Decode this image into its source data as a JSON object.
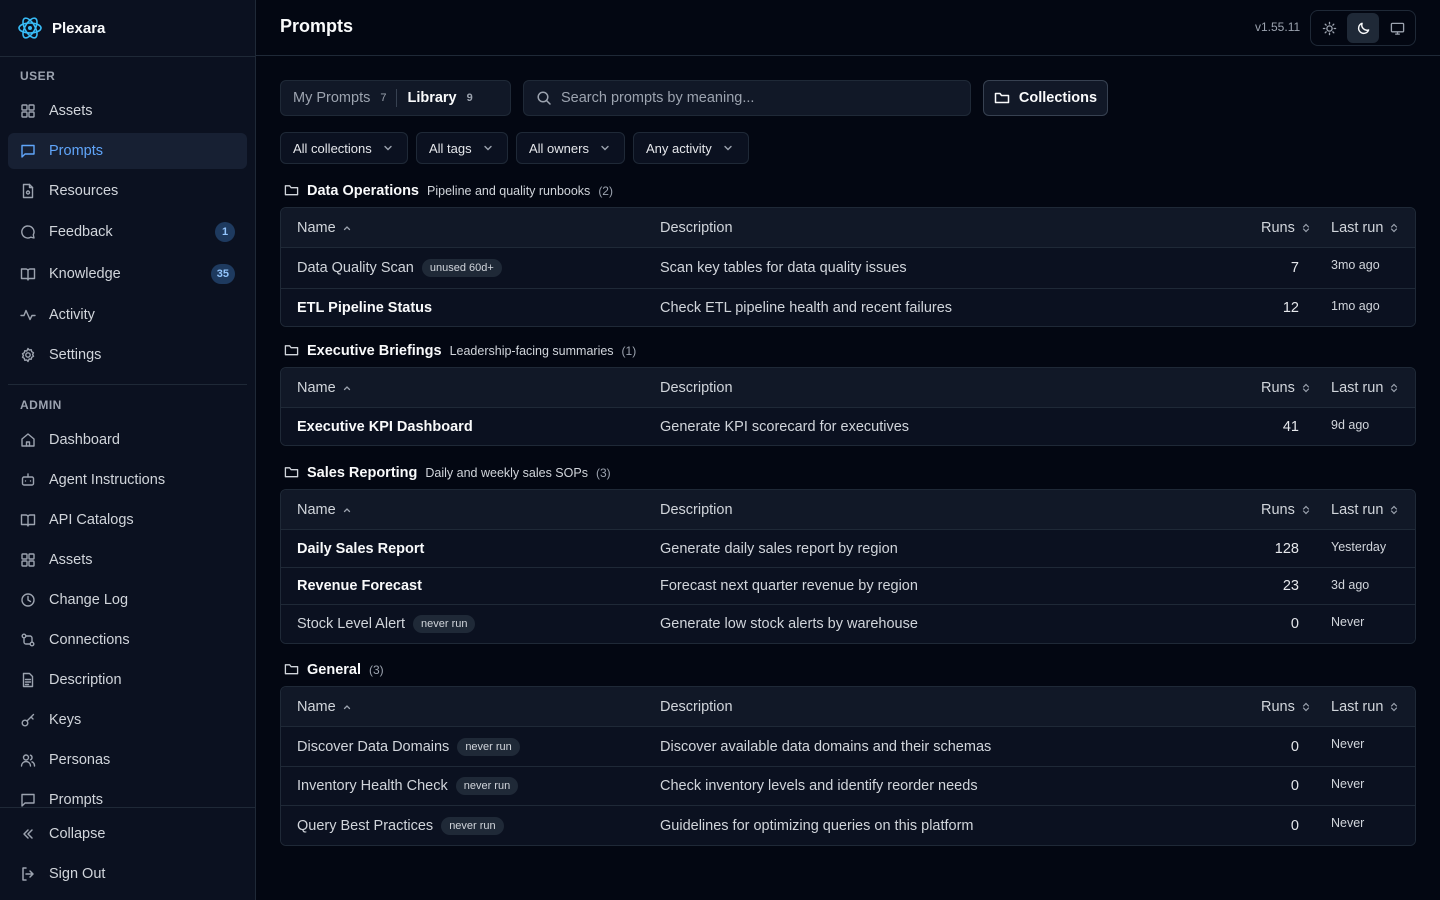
{
  "brand": {
    "name": "Plexara"
  },
  "sidebar": {
    "user_label": "USER",
    "admin_label": "ADMIN",
    "user_items": [
      {
        "label": "Assets",
        "icon": "grid-icon"
      },
      {
        "label": "Prompts",
        "icon": "message-square-icon",
        "active": true
      },
      {
        "label": "Resources",
        "icon": "file-icon"
      },
      {
        "label": "Feedback",
        "icon": "message-circle-icon",
        "badge": "1"
      },
      {
        "label": "Knowledge",
        "icon": "book-open-icon",
        "badge": "35"
      },
      {
        "label": "Activity",
        "icon": "activity-icon"
      },
      {
        "label": "Settings",
        "icon": "gear-icon"
      }
    ],
    "admin_items": [
      {
        "label": "Dashboard",
        "icon": "home-icon"
      },
      {
        "label": "Agent Instructions",
        "icon": "bot-icon"
      },
      {
        "label": "API Catalogs",
        "icon": "book-open-icon"
      },
      {
        "label": "Assets",
        "icon": "grid-icon"
      },
      {
        "label": "Change Log",
        "icon": "clock-icon"
      },
      {
        "label": "Connections",
        "icon": "connections-icon"
      },
      {
        "label": "Description",
        "icon": "file-text-icon"
      },
      {
        "label": "Keys",
        "icon": "key-icon"
      },
      {
        "label": "Personas",
        "icon": "users-icon"
      },
      {
        "label": "Prompts",
        "icon": "message-square-icon"
      }
    ],
    "collapse_label": "Collapse",
    "signout_label": "Sign Out"
  },
  "header": {
    "title": "Prompts",
    "version": "v1.55.11",
    "theme_active": "dark"
  },
  "toolbar": {
    "tabs": [
      {
        "label": "My Prompts",
        "count": "7"
      },
      {
        "label": "Library",
        "count": "9",
        "active": true
      }
    ],
    "search_placeholder": "Search prompts by meaning...",
    "collections_label": "Collections",
    "filters": [
      "All collections",
      "All tags",
      "All owners",
      "Any activity"
    ]
  },
  "columns": {
    "name": "Name",
    "description": "Description",
    "runs": "Runs",
    "last_run": "Last run"
  },
  "groups": [
    {
      "name": "Data Operations",
      "desc": "Pipeline and quality runbooks",
      "count": "(2)",
      "rows": [
        {
          "name": "Data Quality Scan",
          "tag": "unused 60d+",
          "description": "Scan key tables for data quality issues",
          "runs": "7",
          "last_run": "3mo ago"
        },
        {
          "name": "ETL Pipeline Status",
          "tag": "",
          "description": "Check ETL pipeline health and recent failures",
          "runs": "12",
          "last_run": "1mo ago"
        }
      ]
    },
    {
      "name": "Executive Briefings",
      "desc": "Leadership-facing summaries",
      "count": "(1)",
      "rows": [
        {
          "name": "Executive KPI Dashboard",
          "tag": "",
          "description": "Generate KPI scorecard for executives",
          "runs": "41",
          "last_run": "9d ago"
        }
      ]
    },
    {
      "name": "Sales Reporting",
      "desc": "Daily and weekly sales SOPs",
      "count": "(3)",
      "rows": [
        {
          "name": "Daily Sales Report",
          "tag": "",
          "description": "Generate daily sales report by region",
          "runs": "128",
          "last_run": "Yesterday"
        },
        {
          "name": "Revenue Forecast",
          "tag": "",
          "description": "Forecast next quarter revenue by region",
          "runs": "23",
          "last_run": "3d ago"
        },
        {
          "name": "Stock Level Alert",
          "tag": "never run",
          "description": "Generate low stock alerts by warehouse",
          "runs": "0",
          "last_run": "Never"
        }
      ]
    },
    {
      "name": "General",
      "desc": "",
      "count": "(3)",
      "rows": [
        {
          "name": "Discover Data Domains",
          "tag": "never run",
          "description": "Discover available data domains and their schemas",
          "runs": "0",
          "last_run": "Never"
        },
        {
          "name": "Inventory Health Check",
          "tag": "never run",
          "description": "Check inventory levels and identify reorder needs",
          "runs": "0",
          "last_run": "Never"
        },
        {
          "name": "Query Best Practices",
          "tag": "never run",
          "description": "Guidelines for optimizing queries on this platform",
          "runs": "0",
          "last_run": "Never"
        }
      ]
    }
  ],
  "colors": {
    "accent": "#60a5fa",
    "background": "#030712",
    "sidebar": "#0b1120",
    "border": "#1f2937"
  }
}
